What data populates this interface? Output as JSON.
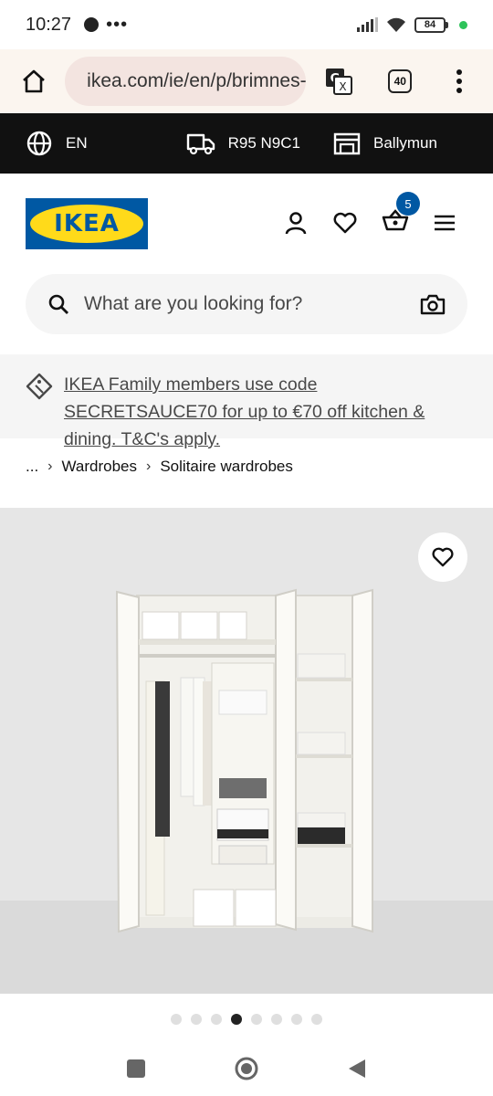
{
  "status_bar": {
    "time": "10:27",
    "more": "•••",
    "battery": "84"
  },
  "browser": {
    "url": "ikea.com/ie/en/p/brimnes-wardrobe",
    "tab_count": "40",
    "icons": [
      "home-icon",
      "site-settings-icon",
      "translate-icon",
      "tabs-icon",
      "more-vert-icon"
    ]
  },
  "topbar": {
    "language": "EN",
    "postcode": "R95 N9C1",
    "store": "Ballymun"
  },
  "header": {
    "logo_text": "IKEA",
    "cart_count": "5"
  },
  "search": {
    "placeholder": "What are you looking for?"
  },
  "promo": {
    "text": "IKEA Family members use code SECRETSAUCE70 for up to €70 off kitchen & dining. T&C's apply."
  },
  "breadcrumb": {
    "ellipsis": "...",
    "items": [
      "Wardrobes",
      "Solitaire wardrobes"
    ]
  },
  "carousel": {
    "total": 8,
    "active_index": 3
  },
  "colors": {
    "ikea_blue": "#0058a3",
    "ikea_yellow": "#ffda1a",
    "topbar_bg": "#111111"
  }
}
